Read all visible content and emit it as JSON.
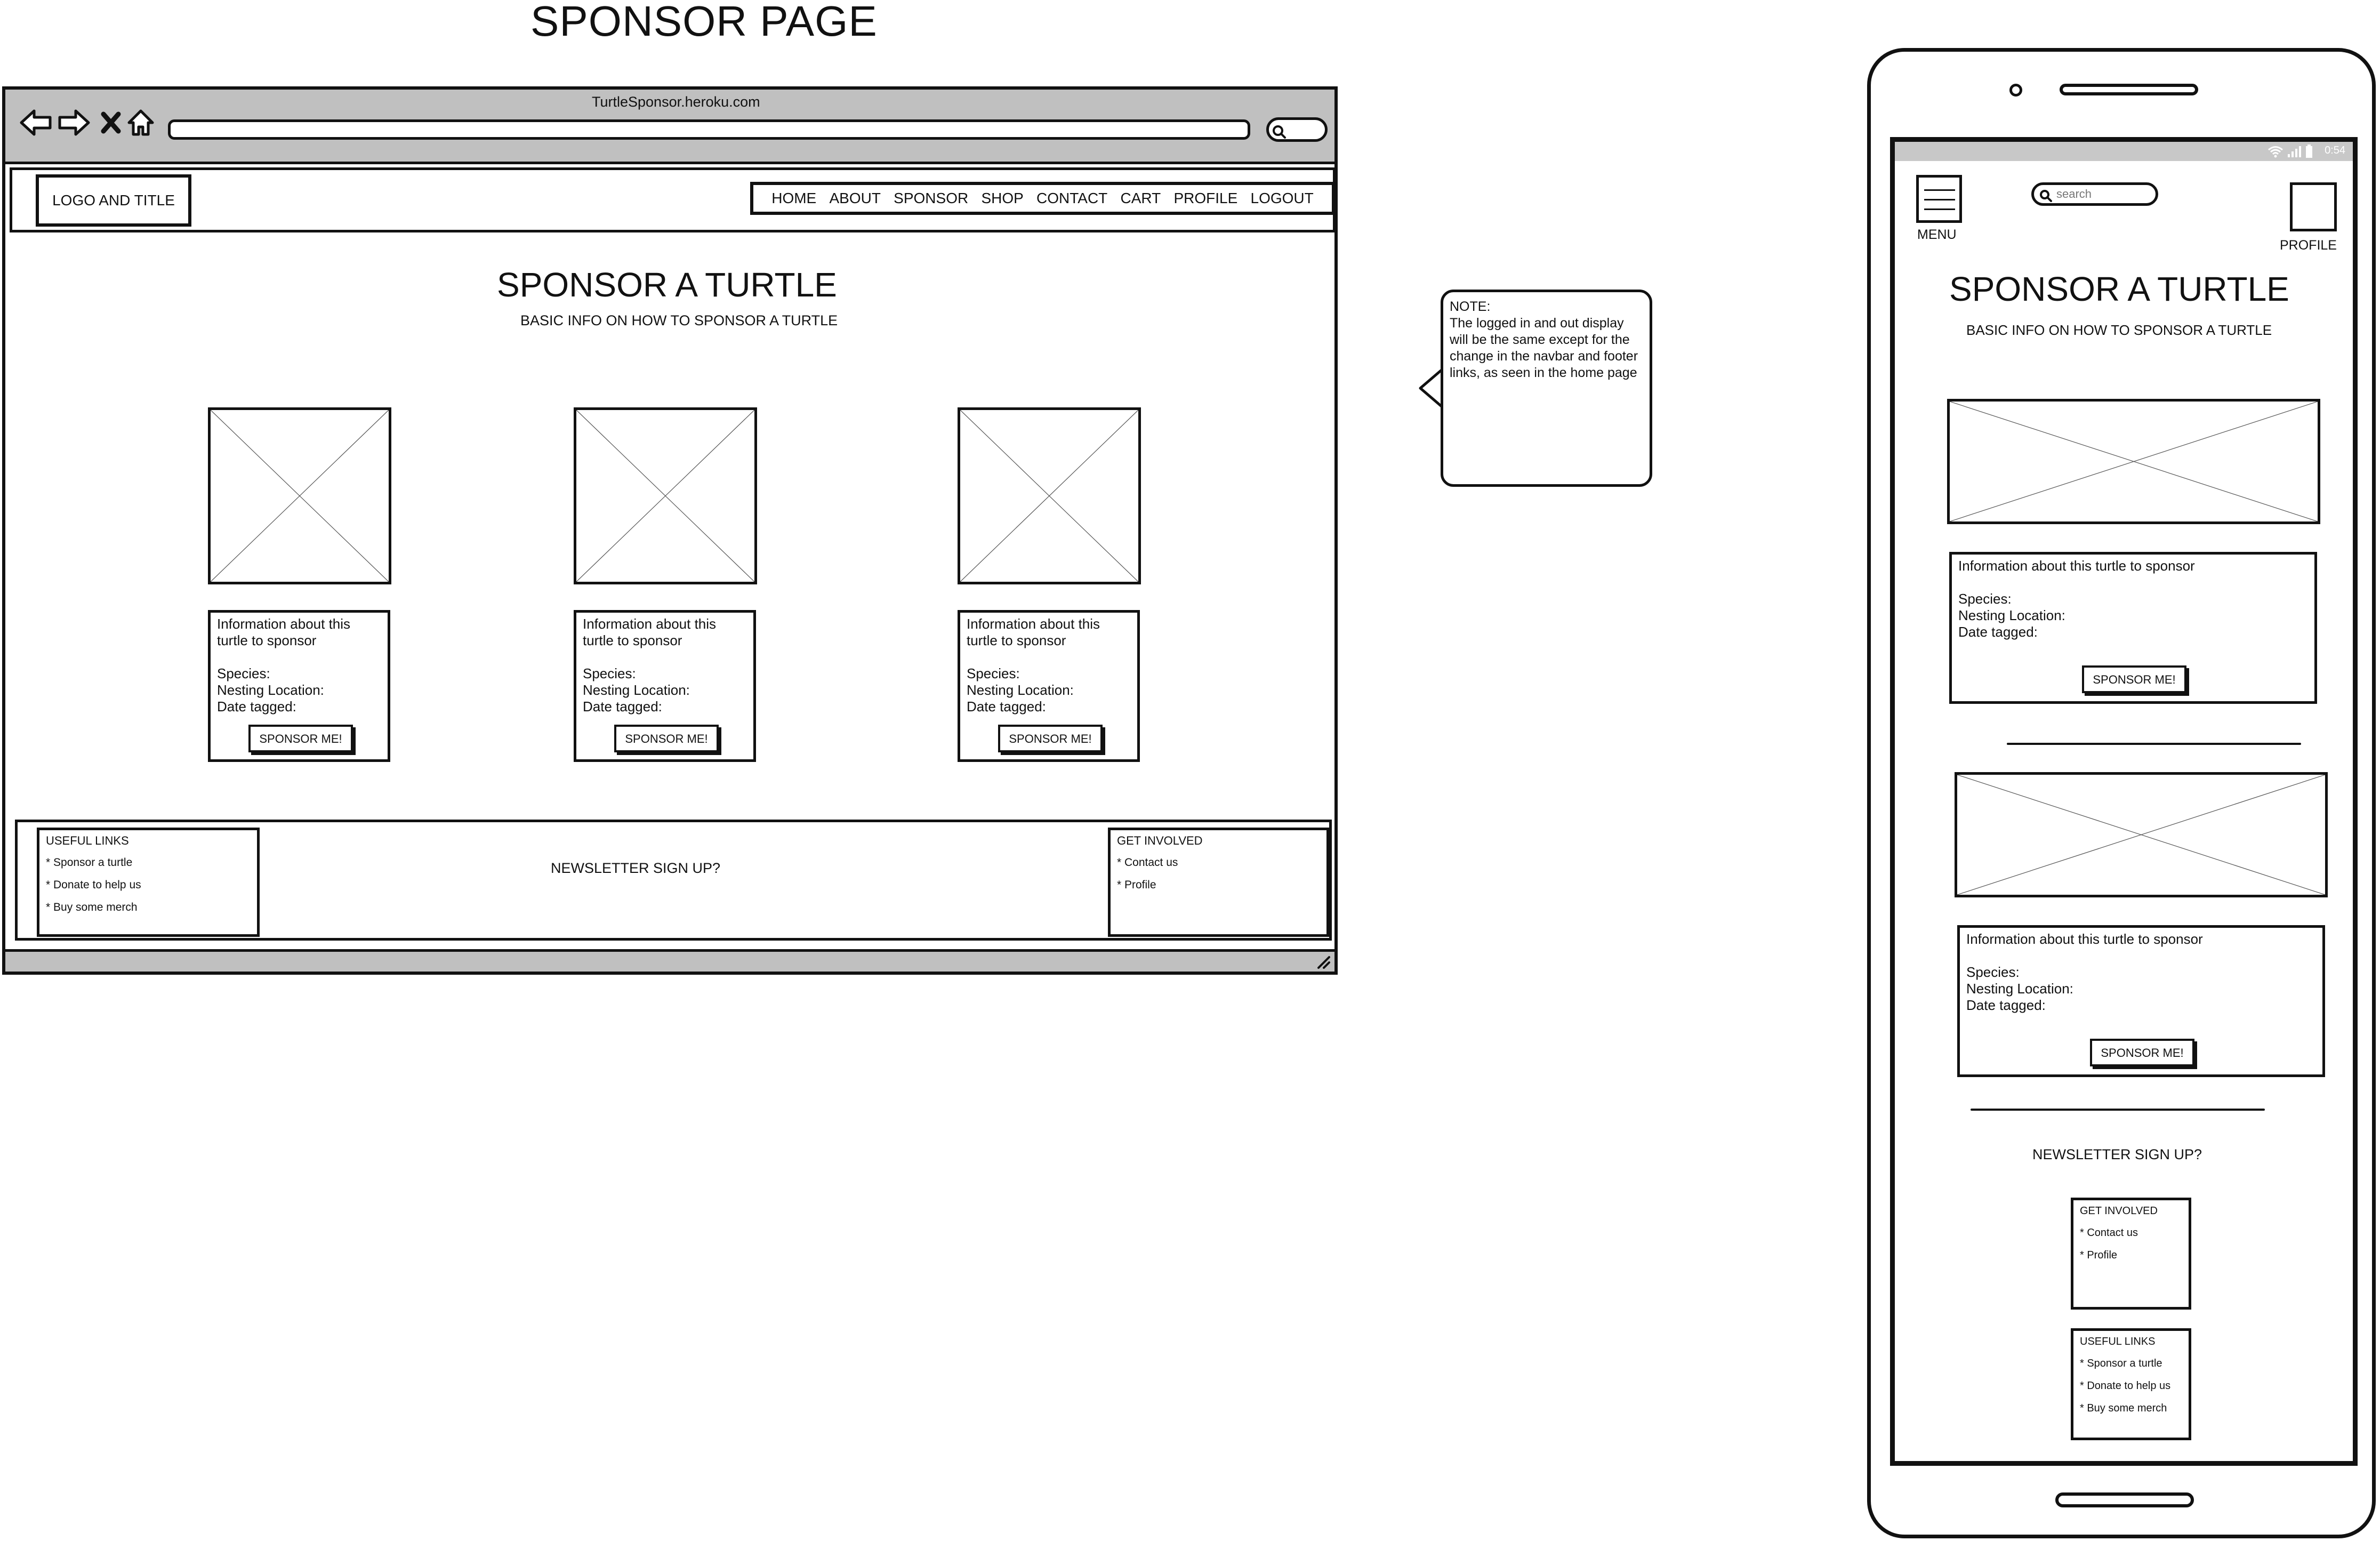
{
  "page_title": "SPONSOR PAGE",
  "browser": {
    "url": "TurtleSponsor.heroku.com",
    "logo_title": "LOGO AND TITLE",
    "nav": [
      "HOME",
      "ABOUT",
      "SPONSOR",
      "SHOP",
      "CONTACT",
      "CART",
      "PROFILE",
      "LOGOUT"
    ],
    "heading": "SPONSOR A TURTLE",
    "subheading": "BASIC INFO ON HOW TO SPONSOR A TURTLE",
    "cards": [
      {
        "info_line1": "Information about this",
        "info_line2": "turtle to sponsor",
        "species": "Species:",
        "nesting": "Nesting Location:",
        "date": "Date tagged:",
        "button": "SPONSOR ME!"
      },
      {
        "info_line1": "Information about this",
        "info_line2": "turtle to sponsor",
        "species": "Species:",
        "nesting": "Nesting Location:",
        "date": "Date tagged:",
        "button": "SPONSOR ME!"
      },
      {
        "info_line1": "Information about this",
        "info_line2": "turtle to sponsor",
        "species": "Species:",
        "nesting": "Nesting Location:",
        "date": "Date tagged:",
        "button": "SPONSOR ME!"
      }
    ],
    "footer": {
      "useful_links_title": "USEFUL LINKS",
      "useful_links": [
        "* Sponsor a turtle",
        "* Donate to help us",
        "* Buy some merch"
      ],
      "newsletter": "NEWSLETTER SIGN UP?",
      "get_involved_title": "GET INVOLVED",
      "get_involved": [
        "* Contact us",
        "* Profile"
      ]
    }
  },
  "note": {
    "title": "NOTE:",
    "text": "The logged in and out display will be the same except for the change in the navbar and footer links, as seen in the home page"
  },
  "mobile": {
    "status_time": "0:54",
    "menu_label": "MENU",
    "search_placeholder": "search",
    "profile_label": "PROFILE",
    "heading": "SPONSOR A TURTLE",
    "subheading": "BASIC INFO ON HOW TO SPONSOR A TURTLE",
    "cards": [
      {
        "info": "Information about this turtle to sponsor",
        "species": "Species:",
        "nesting": "Nesting Location:",
        "date": "Date tagged:",
        "button": "SPONSOR ME!"
      },
      {
        "info": "Information about this turtle to sponsor",
        "species": "Species:",
        "nesting": "Nesting Location:",
        "date": "Date tagged:",
        "button": "SPONSOR ME!"
      }
    ],
    "newsletter": "NEWSLETTER SIGN UP?",
    "get_involved_title": "GET INVOLVED",
    "get_involved": [
      "* Contact us",
      "* Profile"
    ],
    "useful_links_title": "USEFUL LINKS",
    "useful_links": [
      "* Sponsor a turtle",
      "* Donate to help us",
      "* Buy some merch"
    ]
  }
}
